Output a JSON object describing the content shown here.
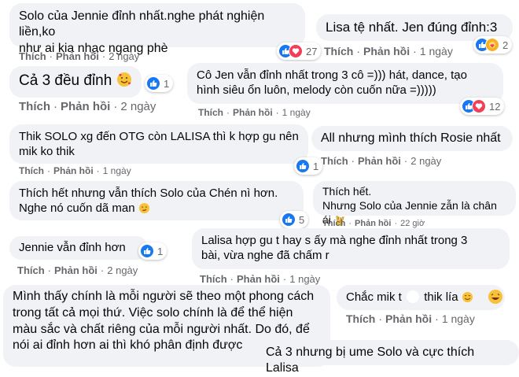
{
  "icons": {
    "like": "like-icon",
    "love": "love-icon",
    "care": "care-icon"
  },
  "colors": {
    "like": "#1877f2",
    "love": "#f33e58",
    "care": "#f7b125",
    "bubble": "#f0f2f5",
    "meta": "#65676b"
  },
  "actions": {
    "like": "Thích",
    "reply": "Phản hồi",
    "sep": "·"
  },
  "comments": {
    "c1": {
      "line1": "Solo của Jennie đỉnh nhất.nghe phát nghiện liền,ko",
      "line2": "như ai kia nhạc ngang phè",
      "time": "2 ngày",
      "reactions": "27"
    },
    "c2": {
      "text": "Lisa tệ nhất. Jen đúng đỉnh:3",
      "time": "1 ngày",
      "reactions": "2"
    },
    "c3": {
      "text": "Cả 3 đều đỉnh",
      "time": "2 ngày",
      "reactions": "1"
    },
    "c4": {
      "line1": "Cô Jen vẫn đỉnh nhất trong 3 cô =))) hát, dance, tạo",
      "line2": "hình siêu ổn luôn, melody còn cuốn nữa =)))))",
      "time": "1 ngày",
      "reactions": "12"
    },
    "c5": {
      "line1": "Thik SOLO xg đến OTG còn LALISA thì k hợp gu nên",
      "line2": "mik ko thik",
      "time": "1 ngày",
      "reactions": "1"
    },
    "c6": {
      "text": "All nhưng mình thích Rosie nhất",
      "time": "2 ngày"
    },
    "c7": {
      "line1": "Thích hết nhưng vẫn thích Solo của Chén nì hơn.",
      "line2": "Nghe nó cuốn dã man",
      "reactions": "5"
    },
    "c8": {
      "line1": "Thích hết.",
      "line2": "Nhưng Solo của Jennie zẫn là chân ái",
      "time": "22 giờ"
    },
    "c9": {
      "text": "Jennie vẫn đỉnh hơn",
      "time": "2 ngày",
      "reactions": "1"
    },
    "c10": {
      "line1": "Lalisa hợp gu t hay s ấy mà nghe đỉnh nhất trong 3",
      "line2": "bài, vừa nghe đã chấm r",
      "time": "1 ngày"
    },
    "c11": {
      "line1": "Mình thấy chính là mỗi người sẽ theo một phong cách",
      "line2": "trong tất cả mọi thứ. Việc solo chính là để thể hiện",
      "line3": "màu sắc và chất riêng của mỗi người nhất. Do đó, để",
      "line4": "nói ai đỉnh hơn ai thì khó phân định được"
    },
    "c12": {
      "text1": "Chắc mik t",
      "text2": "thik lía",
      "time": "1 ngày"
    },
    "c13": {
      "text": "Cả 3 nhưng bị ume Solo và cực thích Lalisa"
    }
  }
}
